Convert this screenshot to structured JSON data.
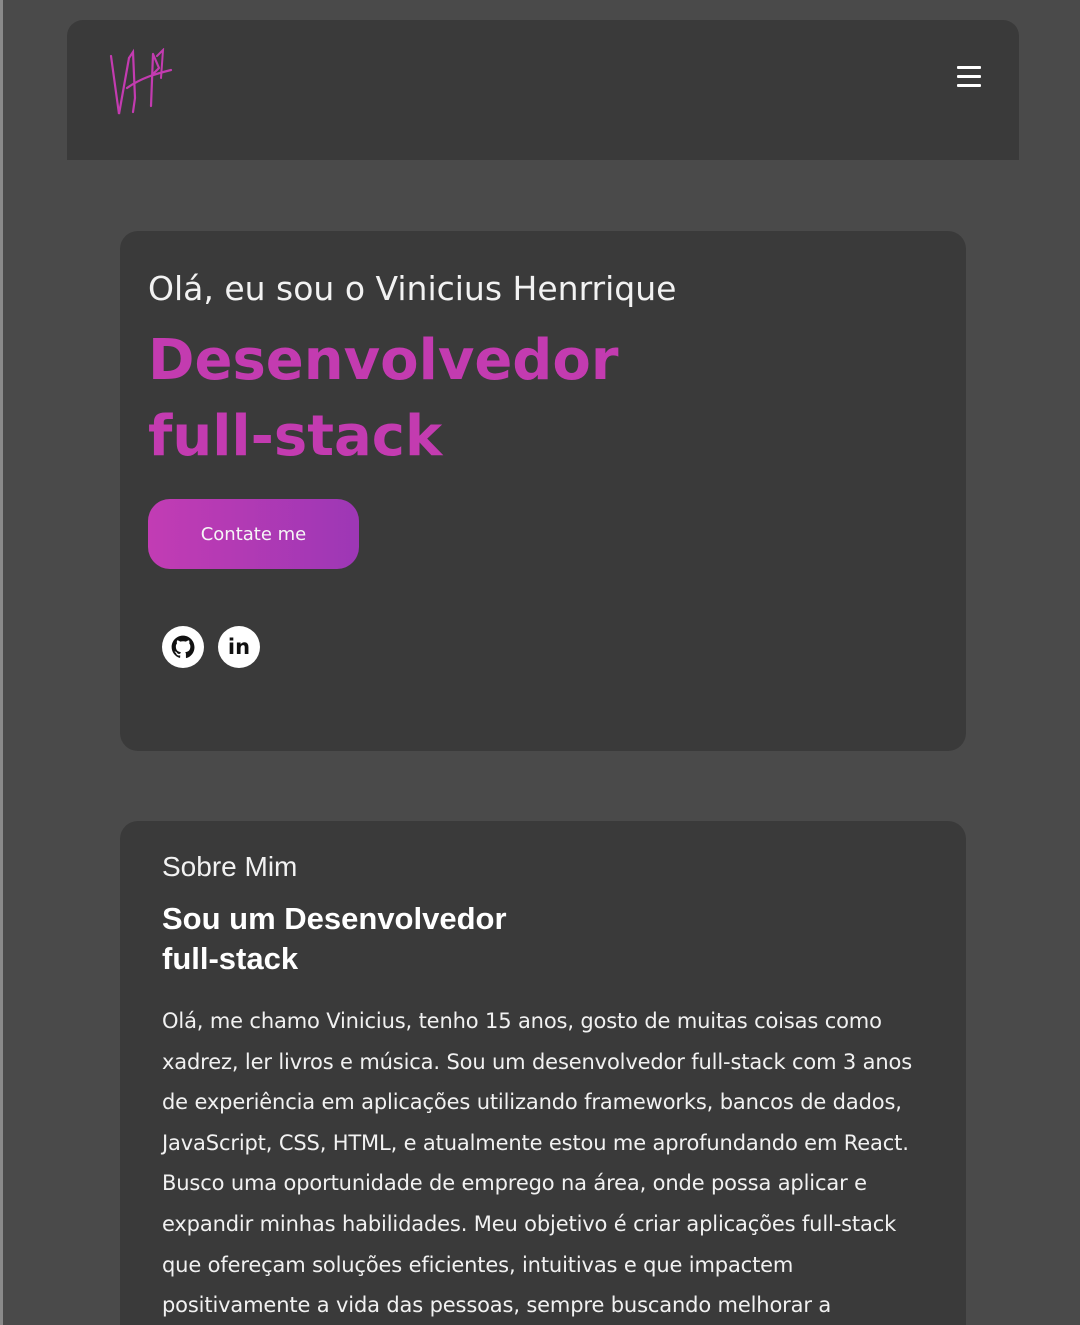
{
  "header": {
    "logo_text": "VH",
    "menu_icon": "hamburger-menu-icon"
  },
  "hero": {
    "greeting": "Olá, eu sou o Vinicius Henrrique",
    "title_line1": "Desenvolvedor",
    "title_line2": "full-stack",
    "contact_button": "Contate me",
    "socials": [
      {
        "name": "github",
        "icon": "github-icon"
      },
      {
        "name": "linkedin",
        "icon": "linkedin-icon",
        "label": "in"
      }
    ]
  },
  "about": {
    "label": "Sobre Mim",
    "title_line1": "Sou um Desenvolvedor",
    "title_line2": "full-stack",
    "text": "Olá, me chamo Vinicius, tenho 15 anos, gosto de muitas coisas como xadrez, ler livros e música. Sou um desenvolvedor full-stack com 3 anos de experiência em aplicações utilizando frameworks, bancos de dados, JavaScript, CSS, HTML, e atualmente estou me aprofundando em React. Busco uma oportunidade de emprego na área, onde possa aplicar e expandir minhas habilidades. Meu objetivo é criar aplicações full-stack que ofereçam soluções eficientes, intuitivas e que impactem positivamente a vida das pessoas, sempre buscando melhorar a"
  },
  "colors": {
    "accent": "#c33bb0",
    "card": "#3a3a3a",
    "background": "#4a4a4a"
  }
}
